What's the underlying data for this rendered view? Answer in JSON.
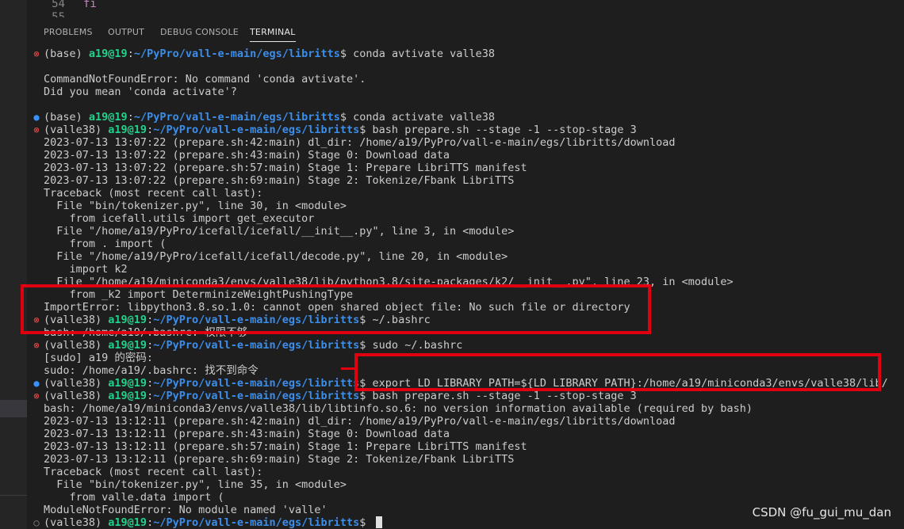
{
  "editor": {
    "line_number": "54",
    "code": "fi",
    "next_line_number": "55"
  },
  "panel_tabs": [
    "PROBLEMS",
    "OUTPUT",
    "DEBUG CONSOLE",
    "TERMINAL"
  ],
  "terminal_lines": [
    {
      "marker": "err",
      "env": "(base) ",
      "user": "a19@19",
      "path": "~/PyPro/vall-e-main/egs/libritts",
      "cmd": "$ conda avtivate valle38"
    },
    {
      "text": ""
    },
    {
      "text": "CommandNotFoundError: No command 'conda avtivate'."
    },
    {
      "text": "Did you mean 'conda activate'?"
    },
    {
      "text": ""
    },
    {
      "marker": "ok",
      "env": "(base) ",
      "user": "a19@19",
      "path": "~/PyPro/vall-e-main/egs/libritts",
      "cmd": "$ conda activate valle38"
    },
    {
      "marker": "err",
      "env": "(valle38) ",
      "user": "a19@19",
      "path": "~/PyPro/vall-e-main/egs/libritts",
      "cmd": "$ bash prepare.sh --stage -1 --stop-stage 3"
    },
    {
      "text": "2023-07-13 13:07:22 (prepare.sh:42:main) dl_dir: /home/a19/PyPro/vall-e-main/egs/libritts/download"
    },
    {
      "text": "2023-07-13 13:07:22 (prepare.sh:43:main) Stage 0: Download data"
    },
    {
      "text": "2023-07-13 13:07:22 (prepare.sh:57:main) Stage 1: Prepare LibriTTS manifest"
    },
    {
      "text": "2023-07-13 13:07:22 (prepare.sh:69:main) Stage 2: Tokenize/Fbank LibriTTS"
    },
    {
      "text": "Traceback (most recent call last):"
    },
    {
      "text": "  File \"bin/tokenizer.py\", line 30, in <module>"
    },
    {
      "text": "    from icefall.utils import get_executor"
    },
    {
      "text": "  File \"/home/a19/PyPro/icefall/icefall/__init__.py\", line 3, in <module>"
    },
    {
      "text": "    from . import ("
    },
    {
      "text": "  File \"/home/a19/PyPro/icefall/icefall/decode.py\", line 20, in <module>"
    },
    {
      "text": "    import k2"
    },
    {
      "text": "  File \"/home/a19/miniconda3/envs/valle38/lib/python3.8/site-packages/k2/__init__.py\", line 23, in <module>"
    },
    {
      "text": "    from _k2 import DeterminizeWeightPushingType"
    },
    {
      "text": "ImportError: libpython3.8.so.1.0: cannot open shared object file: No such file or directory"
    },
    {
      "marker": "err",
      "env": "(valle38) ",
      "user": "a19@19",
      "path": "~/PyPro/vall-e-main/egs/libritts",
      "cmd": "$ ~/.bashrc"
    },
    {
      "text": "bash: /home/a19/.bashrc: 权限不够"
    },
    {
      "marker": "err",
      "env": "(valle38) ",
      "user": "a19@19",
      "path": "~/PyPro/vall-e-main/egs/libritts",
      "cmd": "$ sudo ~/.bashrc"
    },
    {
      "text": "[sudo] a19 的密码:"
    },
    {
      "text": "sudo: /home/a19/.bashrc: 找不到命令"
    },
    {
      "marker": "ok",
      "env": "(valle38) ",
      "user": "a19@19",
      "path": "~/PyPro/vall-e-main/egs/libritts",
      "cmd": "$ export LD_LIBRARY_PATH=${LD_LIBRARY_PATH}:/home/a19/miniconda3/envs/valle38/lib/"
    },
    {
      "marker": "err",
      "env": "(valle38) ",
      "user": "a19@19",
      "path": "~/PyPro/vall-e-main/egs/libritts",
      "cmd": "$ bash prepare.sh --stage -1 --stop-stage 3"
    },
    {
      "text": "bash: /home/a19/miniconda3/envs/valle38/lib/libtinfo.so.6: no version information available (required by bash)"
    },
    {
      "text": "2023-07-13 13:12:11 (prepare.sh:42:main) dl_dir: /home/a19/PyPro/vall-e-main/egs/libritts/download"
    },
    {
      "text": "2023-07-13 13:12:11 (prepare.sh:43:main) Stage 0: Download data"
    },
    {
      "text": "2023-07-13 13:12:11 (prepare.sh:57:main) Stage 1: Prepare LibriTTS manifest"
    },
    {
      "text": "2023-07-13 13:12:11 (prepare.sh:69:main) Stage 2: Tokenize/Fbank LibriTTS"
    },
    {
      "text": "Traceback (most recent call last):"
    },
    {
      "text": "  File \"bin/tokenizer.py\", line 35, in <module>"
    },
    {
      "text": "    from valle.data import ("
    },
    {
      "text": "ModuleNotFoundError: No module named 'valle'"
    },
    {
      "marker": "idle",
      "env": "(valle38) ",
      "user": "a19@19",
      "path": "~/PyPro/vall-e-main/egs/libritts",
      "cmd": "$ ",
      "cursor": true
    }
  ],
  "watermark": "CSDN @fu_gui_mu_dan",
  "colors": {
    "user": "#23d18b",
    "path": "#3b8eea",
    "error_marker": "#f14c4c",
    "success_marker": "#3794ff",
    "highlight_box": "#e0000f"
  },
  "icons": {
    "error_marker": "circle-x-icon",
    "success_marker": "filled-circle-icon",
    "idle_marker": "hollow-circle-icon"
  }
}
